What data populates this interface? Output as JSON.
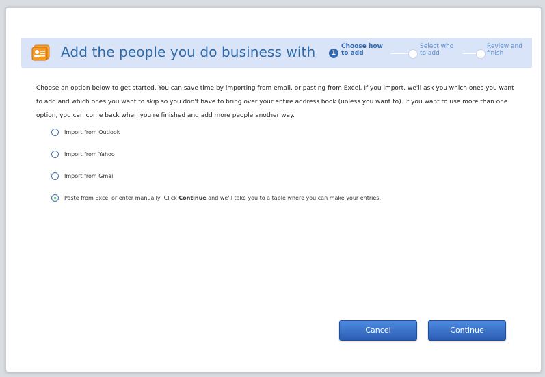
{
  "header": {
    "title": "Add the people you do business with",
    "icon": "contacts-card-icon"
  },
  "steps": [
    {
      "number": "1",
      "line1": "Choose how",
      "line2": "to add",
      "state": "active"
    },
    {
      "number": "",
      "line1": "Select who",
      "line2": "to add",
      "state": "inactive"
    },
    {
      "number": "",
      "line1": "Review and",
      "line2": "finish",
      "state": "inactive"
    }
  ],
  "intro_text": "Choose an option below to get started. You can save time by importing from email, or pasting from Excel. If you import, we'll ask you which ones you want to add and which ones you want to skip so you don't have to bring over your entire address book (unless you want to). If you want to use more than one option, you can come back when you're finished and add more people another way.",
  "options": [
    {
      "label": "Import from Outlook",
      "checked": false
    },
    {
      "label": "Import from Yahoo",
      "checked": false
    },
    {
      "label": "Import from Gmai",
      "checked": false
    },
    {
      "label": "Paste from Excel or enter manually",
      "checked": true,
      "help_prefix": "Click",
      "help_bold": "Continue",
      "help_suffix": "and we'll take you to a table where you can make your entries."
    }
  ],
  "buttons": {
    "cancel": "Cancel",
    "continue": "Continue"
  },
  "colors": {
    "accent": "#2f6aa8",
    "banner": "#d9e4f8",
    "button": "#3a73cc"
  }
}
